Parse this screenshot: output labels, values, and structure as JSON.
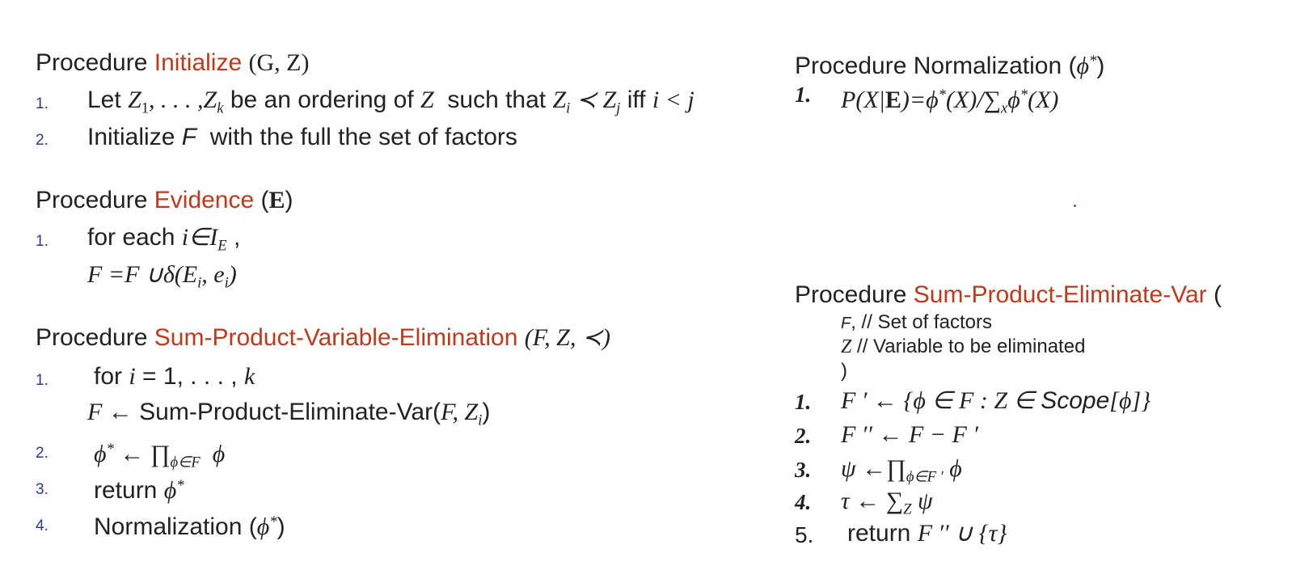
{
  "left": {
    "initialize": {
      "keyword": "Procedure",
      "name": "Initialize",
      "args": "(G, Z)",
      "steps": [
        {
          "num": "1.",
          "text_a": "Let",
          "math_a": "Z",
          "math_b": "1",
          "text_b": ", . . . ,",
          "math_c": "Z",
          "math_d": "k",
          "text_c": "be an ordering of",
          "math_e": "Z",
          "text_d": "such that",
          "math_f": "Z",
          "math_g": "i",
          "math_h": "≺ Z",
          "math_i": "j",
          "text_e": "iff",
          "math_j": "i < j"
        },
        {
          "num": "2.",
          "text_a": "Initialize",
          "math_a": "F",
          "text_b": "with the full the set of factors"
        }
      ]
    },
    "evidence": {
      "keyword": "Procedure",
      "name": "Evidence",
      "arg_open": "(",
      "arg": "E",
      "arg_close": ")",
      "steps": [
        {
          "num": "1.",
          "text_a": "for",
          "text_b": "each",
          "math_a": "i∈I",
          "math_b": "E",
          "text_c": ","
        },
        {
          "num": "",
          "math_a": "F =F ∪δ(E",
          "math_b": "i",
          "math_c": ", e",
          "math_d": "i",
          "math_e": ")"
        }
      ]
    },
    "spve": {
      "keyword": "Procedure",
      "name": "Sum-Product-Variable-Elimination",
      "args": "(F, Z, ≺)",
      "steps": [
        {
          "num": "1.",
          "text_a": "for",
          "math_a": "i",
          "text_b": "= 1, . . . ,",
          "math_b": "k"
        },
        {
          "num": "",
          "math_a": "F ←",
          "text_a": "Sum-Product-Eliminate-Var(",
          "math_b": "F, Z",
          "math_c": "i",
          "text_b": ")"
        },
        {
          "num": "2.",
          "math_a": "ϕ",
          "math_b": "*",
          "math_c": "← ∏",
          "math_d": "ϕ∈F",
          "math_e": "ϕ"
        },
        {
          "num": "3.",
          "text_a": "return",
          "math_a": "ϕ",
          "math_b": "*"
        },
        {
          "num": "4.",
          "text_a": "Normalization (",
          "math_a": "ϕ",
          "math_b": "*",
          "text_b": ")"
        }
      ]
    }
  },
  "right": {
    "normalization": {
      "keyword": "Procedure",
      "name": "Normalization",
      "args_open": "(",
      "arg": "ϕ",
      "arg_sup": "*",
      "args_close": ")",
      "steps": [
        {
          "num": "1.",
          "math_a": "P(X|",
          "math_b": "E",
          "math_c": ")=ϕ",
          "math_d": "*",
          "math_e": "(X)/∑",
          "math_f": "x",
          "math_g": "ϕ",
          "math_h": "*",
          "math_i": "(X)"
        }
      ]
    },
    "speve": {
      "keyword": "Procedure",
      "name": "Sum-Product-Eliminate-Var",
      "args_open": "(",
      "param1_var": "F",
      "param1_text": ", // Set of factors",
      "param2_var": "Z",
      "param2_text": "// Variable to be eliminated",
      "args_close": ")",
      "steps": [
        {
          "num": "1.",
          "math_a": "F ′ ← {ϕ ∈ F  : Z ∈",
          "math_b": "Scope",
          "math_c": "[ϕ]}"
        },
        {
          "num": "2.",
          "math_a": "F ′′ ← F  − F ′"
        },
        {
          "num": "3.",
          "math_a": "ψ ←∏",
          "math_b": "ϕ∈F ′",
          "math_c": "ϕ"
        },
        {
          "num": "4.",
          "math_a": "τ ← ∑",
          "math_b": "Z",
          "math_c": "ψ"
        },
        {
          "num": "5.",
          "text_a": "return",
          "math_a": "F ′′ ∪ {τ}"
        }
      ]
    }
  },
  "colors": {
    "accent": "#c0391b",
    "number": "#2a3a8f",
    "text": "#222222"
  }
}
